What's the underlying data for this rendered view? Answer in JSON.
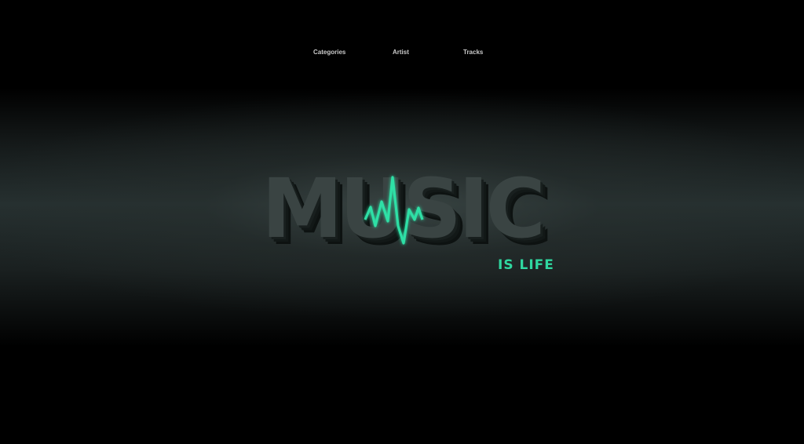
{
  "nav": {
    "items": [
      {
        "label": "Categories"
      },
      {
        "label": "Artist"
      },
      {
        "label": "Tracks"
      }
    ]
  },
  "hero": {
    "title": "MUSIC",
    "tagline": "IS LIFE",
    "accent_color": "#2fe0a6",
    "text_color": "#3a4443",
    "text_shadow_color": "#141a19",
    "icon": "heartbeat-line-icon"
  }
}
